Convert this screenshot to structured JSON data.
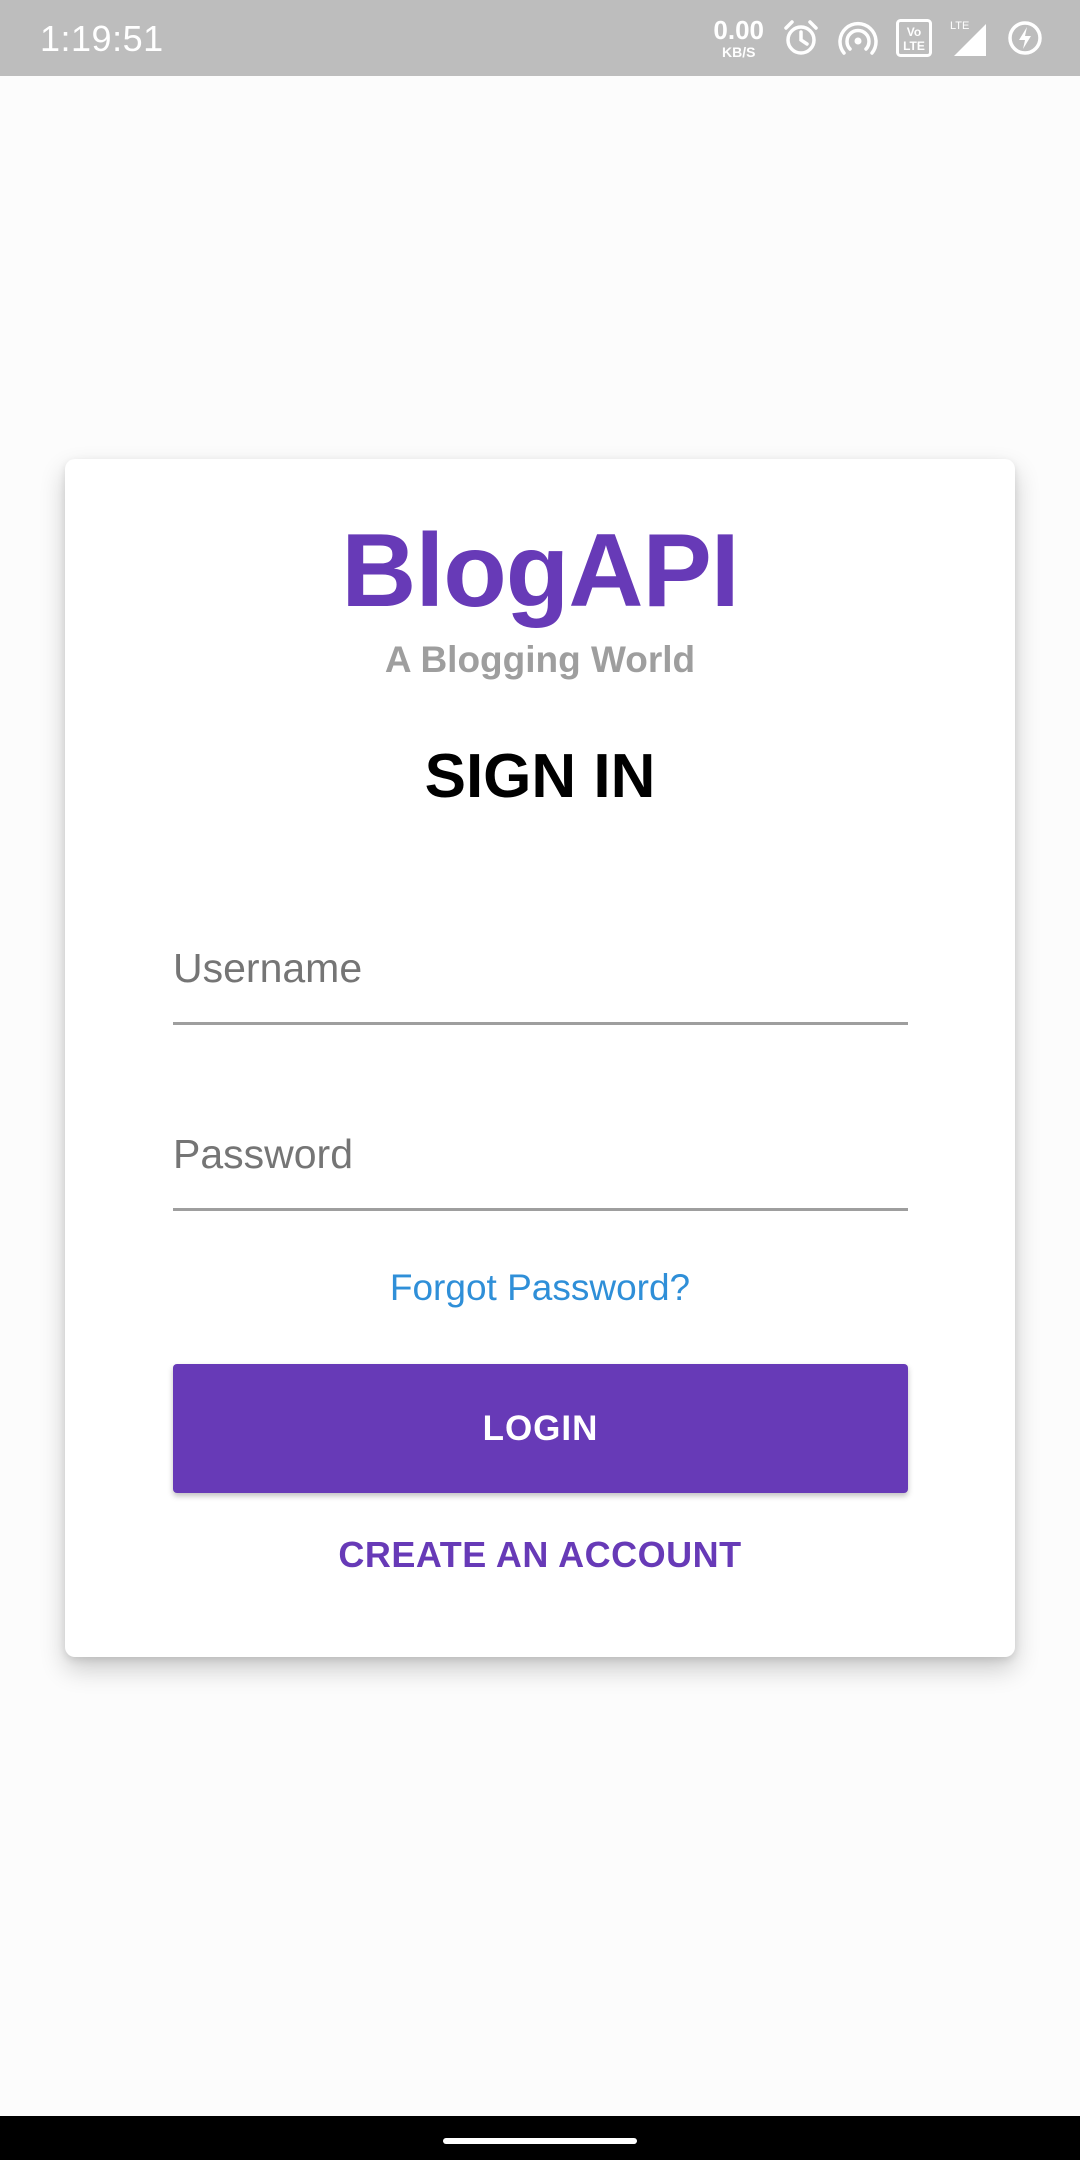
{
  "status_bar": {
    "time": "1:19:51",
    "net_speed_value": "0.00",
    "net_speed_unit": "KB/S",
    "icons": [
      "alarm-icon",
      "hotspot-icon",
      "volte-icon",
      "lte-signal-icon",
      "battery-charging-icon"
    ],
    "volte_label": "VoLTE",
    "lte_label": "LTE"
  },
  "card": {
    "brand": "BlogAPI",
    "tagline": "A Blogging World",
    "title": "SIGN IN",
    "username_placeholder": "Username",
    "password_placeholder": "Password",
    "forgot_password": "Forgot Password?",
    "login_label": "LOGIN",
    "create_account_label": "CREATE AN ACCOUNT"
  },
  "colors": {
    "accent": "#673ab7",
    "link": "#2f8fd8",
    "status_bar": "#bdbdbd"
  }
}
